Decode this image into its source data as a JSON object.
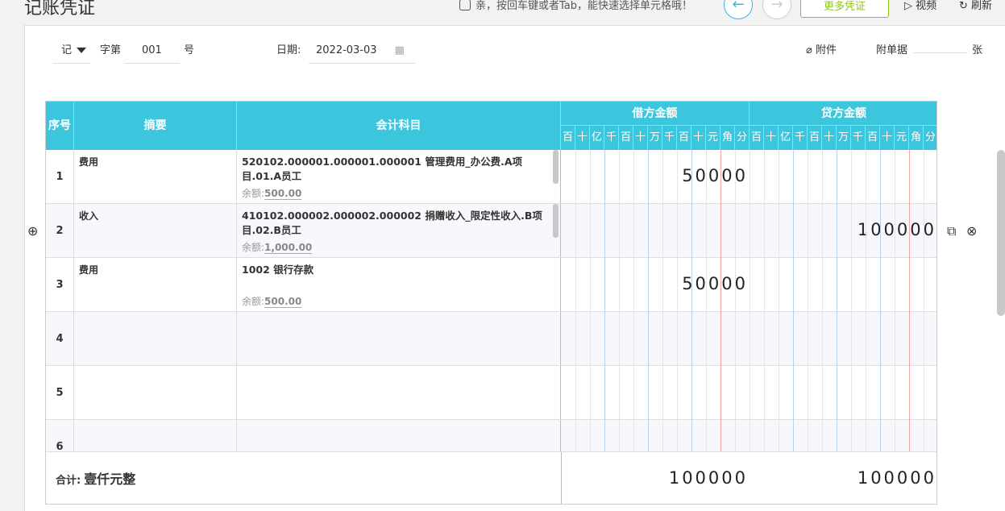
{
  "header": {
    "title": "记账凭证",
    "hint": "亲，按回车键或者Tab，能快速选择单元格哦！",
    "prev_icon": "←",
    "next_icon": "→",
    "more_label": "更多凭证",
    "video_label": "视频",
    "refresh_label": "刷新"
  },
  "voucher": {
    "type": "记",
    "zi_label": "字第",
    "number": "001",
    "hao_label": "号",
    "date_label": "日期:",
    "date": "2022-03-03",
    "attach_label": "附件",
    "attach_doc_label": "附单据",
    "attach_count": "",
    "zhang_label": "张"
  },
  "table": {
    "col_index": "序号",
    "col_summary": "摘要",
    "col_account": "会计科目",
    "col_debit": "借方金额",
    "col_credit": "贷方金额",
    "digits": [
      "百",
      "十",
      "亿",
      "千",
      "百",
      "十",
      "万",
      "千",
      "百",
      "十",
      "元",
      "角",
      "分"
    ]
  },
  "rows": [
    {
      "index": "1",
      "summary": "费用",
      "account": "520102.000001.000001.000001 管理费用_办公费.A项目.01.A员工",
      "balance_label": "余额:",
      "balance": "500.00",
      "debit": "50000",
      "credit": ""
    },
    {
      "index": "2",
      "summary": "收入",
      "account": "410102.000002.000002.000002 捐赠收入_限定性收入.B项目.02.B员工",
      "balance_label": "余额:",
      "balance": "1,000.00",
      "debit": "",
      "credit": "100000"
    },
    {
      "index": "3",
      "summary": "费用",
      "account": "1002 银行存款",
      "balance_label": "余额:",
      "balance": "500.00",
      "debit": "50000",
      "credit": ""
    },
    {
      "index": "4",
      "summary": "",
      "account": "",
      "balance_label": "",
      "balance": "",
      "debit": "",
      "credit": ""
    },
    {
      "index": "5",
      "summary": "",
      "account": "",
      "balance_label": "",
      "balance": "",
      "debit": "",
      "credit": ""
    },
    {
      "index": "6",
      "summary": "",
      "account": "",
      "balance_label": "",
      "balance": "",
      "debit": "",
      "credit": ""
    }
  ],
  "total": {
    "label": "合计:",
    "amount_words": "壹仟元整",
    "debit": "100000",
    "credit": "100000"
  }
}
